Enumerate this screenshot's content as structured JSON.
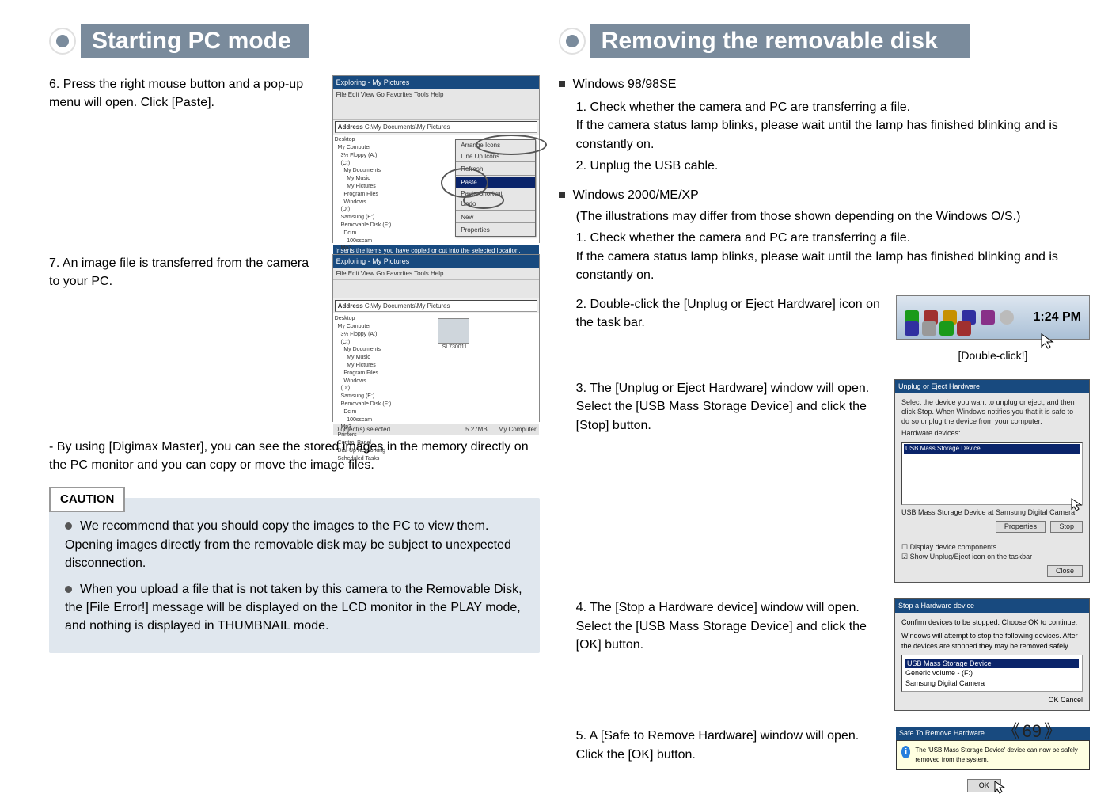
{
  "left": {
    "title": "Starting PC mode",
    "step6": "6. Press the right mouse button and a pop-up menu will open. Click [Paste].",
    "step7": "7. An image file is transferred from the camera to your PC.",
    "note": "- By using [Digimax Master], you can see the stored images in the memory directly on the PC monitor and you can copy or move the image files.",
    "caution_label": "CAUTION",
    "caution1": "We recommend that you should copy the images to the PC to view them. Opening images directly from the removable disk may be subject to unexpected disconnection.",
    "caution2": "When you upload a file that is not taken by this camera to the Removable Disk, the [File Error!] message will be displayed on the LCD monitor in the PLAY mode, and nothing is displayed in THUMBNAIL mode.",
    "shot1": {
      "win_title": "Exploring - My Pictures",
      "menu_items": "File  Edit  View  Go  Favorites  Tools  Help",
      "address_label": "Address",
      "address_value": "C:\\My Documents\\My Pictures",
      "tree": "Desktop\n  My Computer\n    3½ Floppy (A:)\n    (C:)\n      My Documents\n        My Music\n        My Pictures\n      Program Files\n      Windows\n    (D:)\n    Samsung (E:)\n    Removable Disk (F:)\n      Dcim\n        100sscam\n    Mp3\n  Printers\n  Control Panel\n  Dial-Up Networking\n  Scheduled Tasks",
      "ctx_arrange": "Arrange Icons",
      "ctx_lineup": "Line Up Icons",
      "ctx_refresh": "Refresh",
      "ctx_paste": "Paste",
      "ctx_paste_short": "Paste Shortcut",
      "ctx_undo": "Undo",
      "ctx_new": "New",
      "ctx_prop": "Properties",
      "status": "Inserts the items you have copied or cut into the selected location."
    },
    "shot2": {
      "status": "0 object(s) selected",
      "size": "5.27MB",
      "loc": "My Computer",
      "thumb_label": "SL730011"
    }
  },
  "right": {
    "title": "Removing the removable disk",
    "h_win98": "Windows 98/98SE",
    "s98_1": "1. Check whether the camera and PC are transferring a file.\nIf the camera status lamp blinks, please wait until the lamp has finished blinking and is constantly on.",
    "s98_2": "2. Unplug the USB cable.",
    "h_win2k": "Windows 2000/ME/XP",
    "desc2k": "(The illustrations may differ from those shown depending on the Windows O/S.)",
    "s2k_1": "1. Check whether the camera and PC are transferring a file.\nIf the camera status lamp blinks, please wait until the lamp has finished blinking and is constantly on.",
    "s2k_2": "2. Double-click the [Unplug or Eject Hardware] icon on the task bar.",
    "tray_time": "1:24 PM",
    "tray_caption": "[Double-click!]",
    "s2k_3": "3. The [Unplug or Eject Hardware] window will open. Select the [USB Mass Storage Device] and click the [Stop] button.",
    "dlg1": {
      "title": "Unplug or Eject Hardware",
      "intro": "Select the device you want to unplug or eject, and then click Stop. When Windows notifies you that it is safe to do so unplug the device from your computer.",
      "label_hw": "Hardware devices:",
      "item": "USB Mass Storage Device",
      "desc": "USB Mass Storage Device at Samsung Digital Camera",
      "btn_prop": "Properties",
      "btn_stop": "Stop",
      "cb_display": "Display device components",
      "cb_show": "Show Unplug/Eject icon on the taskbar",
      "btn_close": "Close"
    },
    "s2k_4": "4. The [Stop a Hardware device] window will open. Select the [USB Mass Storage Device] and click the [OK] button.",
    "dlg2": {
      "title": "Stop a Hardware device",
      "intro": "Confirm devices to be stopped. Choose OK to continue.",
      "intro2": "Windows will attempt to stop the following devices. After the devices are stopped they may be removed safely.",
      "li1": "USB Mass Storage Device",
      "li2": "Generic volume - (F:)",
      "li3": "Samsung Digital Camera",
      "btn_ok": "OK",
      "btn_cancel": "Cancel"
    },
    "s2k_5": "5. A [Safe to Remove Hardware] window will open. Click the [OK] button.",
    "dlg3": {
      "title": "Safe To Remove Hardware",
      "msg": "The 'USB Mass Storage Device' device can now be safely removed from the system.",
      "btn_ok": "OK"
    }
  },
  "page_number": "69"
}
